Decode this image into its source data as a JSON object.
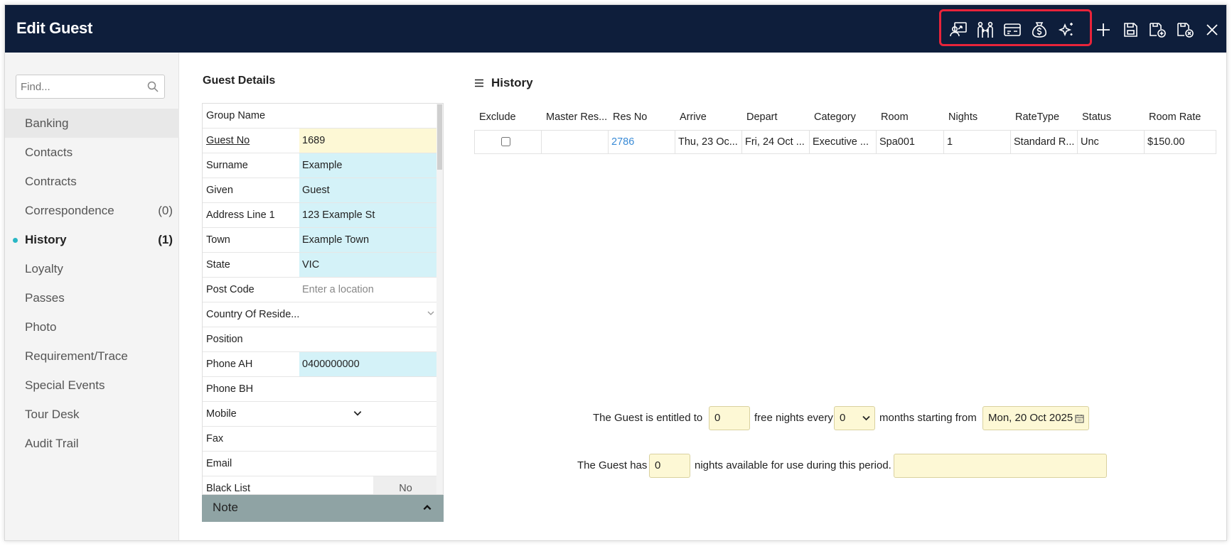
{
  "window": {
    "title": "Edit Guest"
  },
  "toolbar": {
    "icons": [
      "guest-transfer-icon",
      "linked-guests-icon",
      "guest-card-icon",
      "money-bag-icon",
      "sparkles-icon",
      "add-icon",
      "save-icon",
      "save-and-new-icon",
      "save-and-close-icon",
      "close-icon"
    ]
  },
  "sidebar": {
    "search_placeholder": "Find...",
    "items": [
      {
        "label": "Banking",
        "count": ""
      },
      {
        "label": "Contacts",
        "count": ""
      },
      {
        "label": "Contracts",
        "count": ""
      },
      {
        "label": "Correspondence",
        "count": "(0)"
      },
      {
        "label": "History",
        "count": "(1)"
      },
      {
        "label": "Loyalty",
        "count": ""
      },
      {
        "label": "Passes",
        "count": ""
      },
      {
        "label": "Photo",
        "count": ""
      },
      {
        "label": "Requirement/Trace",
        "count": ""
      },
      {
        "label": "Special Events",
        "count": ""
      },
      {
        "label": "Tour Desk",
        "count": ""
      },
      {
        "label": "Audit Trail",
        "count": ""
      }
    ]
  },
  "guest_details": {
    "title": "Guest Details",
    "rows": [
      {
        "label": "Group Name",
        "value": ""
      },
      {
        "label": "Guest No",
        "value": "1689"
      },
      {
        "label": "Surname",
        "value": "Example"
      },
      {
        "label": "Given",
        "value": "Guest"
      },
      {
        "label": "Address Line 1",
        "value": "123 Example St"
      },
      {
        "label": "Town",
        "value": "Example Town"
      },
      {
        "label": "State",
        "value": "VIC"
      },
      {
        "label": "Post Code",
        "value": "",
        "placeholder": "Enter a location"
      },
      {
        "label": "Country Of Reside...",
        "value": ""
      },
      {
        "label": "Position",
        "value": ""
      },
      {
        "label": "Phone AH",
        "value": "0400000000"
      },
      {
        "label": "Phone BH",
        "value": ""
      },
      {
        "label": "Mobile",
        "value": ""
      },
      {
        "label": "Fax",
        "value": ""
      },
      {
        "label": "Email",
        "value": ""
      },
      {
        "label": "Black List",
        "value": "No"
      }
    ],
    "note_label": "Note"
  },
  "history": {
    "title": "History",
    "columns": [
      "Exclude",
      "Master Res...",
      "Res No",
      "Arrive",
      "Depart",
      "Category",
      "Room",
      "Nights",
      "RateType",
      "Status",
      "Room Rate"
    ],
    "rows": [
      {
        "master_res": "",
        "res_no": "2786",
        "arrive": "Thu, 23 Oc...",
        "depart": "Fri, 24 Oct ...",
        "category": "Executive ...",
        "room": "Spa001",
        "nights": "1",
        "rate_type": "Standard R...",
        "status": "Unc",
        "room_rate": "$150.00"
      }
    ]
  },
  "loyalty": {
    "line1_a": "The Guest is entitled to",
    "free_nights": "0",
    "line1_b": "free nights every",
    "months": "0",
    "line1_c": "months starting from",
    "start_date": "Mon, 20 Oct 2025",
    "line2_a": "The Guest has",
    "available_nights": "0",
    "line2_b": "nights available for use during this period.",
    "period_value": ""
  },
  "colors": {
    "titlebar": "#0e1e3b",
    "highlight": "#e8243a",
    "link": "#3a8bd6",
    "cyan_field": "#d4f2f8",
    "yellow_field": "#fdf8d5",
    "active_dot": "#29b7c5"
  }
}
